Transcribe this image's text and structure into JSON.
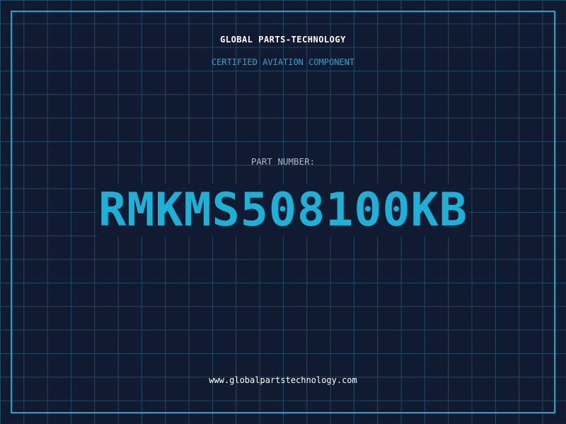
{
  "header": {
    "company": "GLOBAL PARTS-TECHNOLOGY",
    "tagline": "CERTIFIED AVIATION COMPONENT"
  },
  "part": {
    "label": "PART NUMBER:",
    "number": "RMKMS508100KB"
  },
  "footer": {
    "url": "www.globalpartstechnology.com"
  },
  "colors": {
    "background": "#101a30",
    "grid": "#1f4a63",
    "accent": "#16a9cf",
    "text": "#ffffff",
    "muted": "#aeb6c6"
  }
}
